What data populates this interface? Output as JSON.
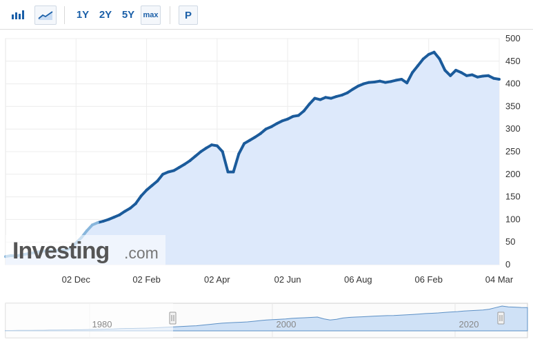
{
  "toolbar": {
    "bar_icon": "bar-chart-icon",
    "line_icon": "line-chart-icon",
    "ranges": [
      "1Y",
      "2Y",
      "5Y"
    ],
    "max_label": "max",
    "p_label": "P"
  },
  "watermark": {
    "brand": "Investing",
    "suffix": ".com"
  },
  "colors": {
    "line": "#1b5b9b",
    "fill": "#dde9fb",
    "early_line": "#88b6dc",
    "accent": "#1a5fa8"
  },
  "chart_data": {
    "type": "area",
    "x_tick_labels": [
      "02 Dec",
      "02 Feb",
      "02 Apr",
      "02 Jun",
      "06 Aug",
      "06 Feb",
      "04 Mar"
    ],
    "y_ticks": [
      0,
      50,
      100,
      150,
      200,
      250,
      300,
      350,
      400,
      450,
      500
    ],
    "ylim": [
      0,
      500
    ],
    "grid": true,
    "y_axis_side": "right",
    "series": [
      {
        "values": [
          18,
          20,
          19,
          22,
          24,
          26,
          28,
          30,
          31,
          30,
          33,
          32,
          36,
          48,
          60,
          75,
          88,
          93,
          96,
          100,
          105,
          110,
          118,
          125,
          135,
          152,
          165,
          175,
          185,
          200,
          205,
          208,
          215,
          222,
          230,
          240,
          250,
          258,
          265,
          263,
          250,
          205,
          205,
          245,
          268,
          275,
          282,
          290,
          300,
          305,
          312,
          318,
          322,
          328,
          330,
          340,
          355,
          368,
          365,
          370,
          368,
          372,
          375,
          380,
          388,
          395,
          400,
          403,
          404,
          406,
          403,
          405,
          408,
          410,
          402,
          425,
          440,
          455,
          465,
          470,
          455,
          430,
          418,
          430,
          425,
          418,
          420,
          415,
          417,
          418,
          412,
          410
        ]
      }
    ]
  },
  "navigator": {
    "labels": [
      "1980",
      "2000",
      "2020"
    ],
    "values": [
      2,
      2,
      3,
      3,
      3,
      4,
      4,
      5,
      5,
      6,
      6,
      7,
      7,
      8,
      9,
      10,
      11,
      12,
      14,
      15,
      15,
      16,
      17,
      18,
      20,
      22,
      24,
      26,
      28,
      30,
      32,
      36,
      40,
      44,
      48,
      50,
      52,
      54,
      56,
      60,
      64,
      68,
      70,
      72,
      74,
      78,
      80,
      82,
      84,
      86,
      75,
      68,
      72,
      80,
      84,
      86,
      88,
      90,
      92,
      94,
      95,
      96,
      98,
      100,
      102,
      105,
      108,
      110,
      112,
      115,
      118,
      120,
      124,
      126,
      128,
      130,
      135,
      145,
      155,
      150,
      148,
      146,
      145
    ]
  }
}
